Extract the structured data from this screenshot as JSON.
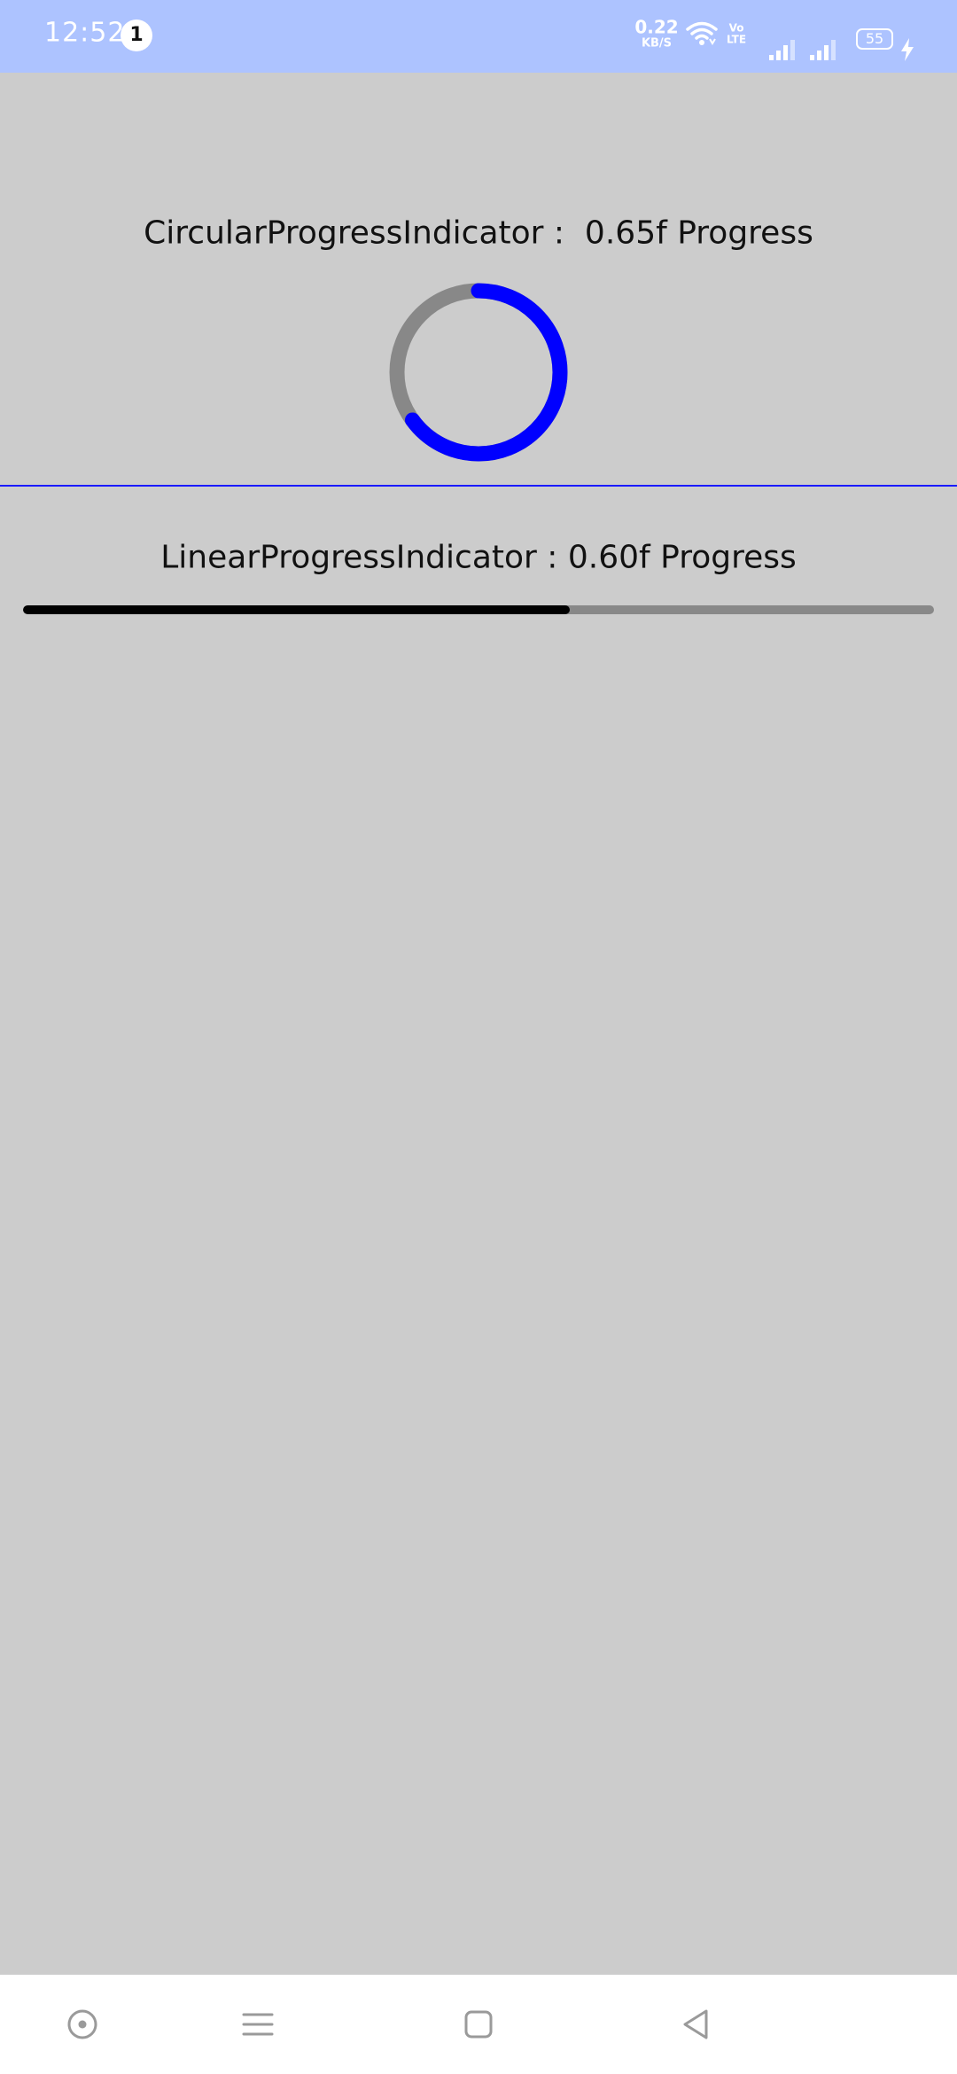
{
  "status_bar": {
    "time": "12:52",
    "notification_count": "1",
    "net_speed_value": "0.22",
    "net_speed_unit": "KB/S",
    "volte_line1": "Vo",
    "volte_line2": "LTE",
    "battery_level": "55",
    "icons": [
      "wifi-icon",
      "signal-icon",
      "signal-icon",
      "charging-icon"
    ]
  },
  "circular": {
    "label": "CircularProgressIndicator :  0.65f Progress",
    "progress": 0.65,
    "color": "#0000ff",
    "track_color": "#888888"
  },
  "divider_color": "#1a1aff",
  "linear": {
    "label": "LinearProgressIndicator : 0.60f Progress",
    "progress": 0.6,
    "color": "#000000",
    "track_color": "#888888"
  },
  "nav_bar": {
    "buttons": [
      "assistant-icon",
      "menu-icon",
      "home-icon",
      "back-icon"
    ]
  },
  "colors": {
    "status_bar_bg": "#adc3ff",
    "background": "#cccccc",
    "nav_bar_bg": "#ffffff"
  }
}
